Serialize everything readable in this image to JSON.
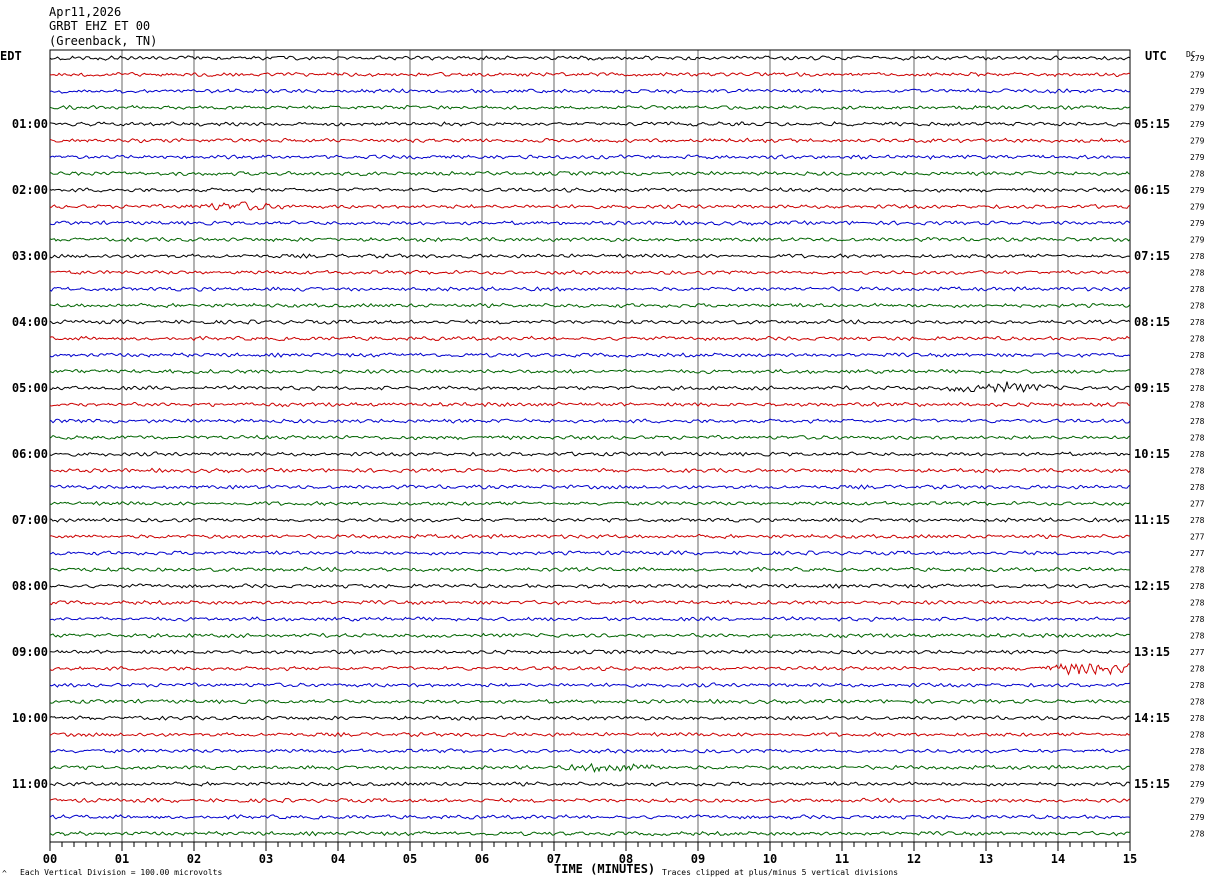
{
  "header": {
    "date": "Apr11,2026",
    "station": "GRBT EHZ ET 00",
    "location": "(Greenback, TN)"
  },
  "left_timezone": "EDT",
  "right_timezone": "UTC",
  "dc_label": "DC",
  "footer": {
    "scale_text": "Each Vertical Division =  100.00 microvolts",
    "clip_text": "Traces clipped at plus/minus 5 vertical divisions",
    "corner_mark": "^"
  },
  "colors": {
    "trace_cycle": [
      "#000000",
      "#cc0000",
      "#0000cc",
      "#006400"
    ],
    "grid": "#000000",
    "background": "#ffffff"
  },
  "chart_data": {
    "type": "line",
    "title": "",
    "xlabel": "TIME (MINUTES)",
    "x_ticks": [
      "00",
      "01",
      "02",
      "03",
      "04",
      "05",
      "06",
      "07",
      "08",
      "09",
      "10",
      "11",
      "12",
      "13",
      "14",
      "15"
    ],
    "xlim": [
      0,
      15
    ],
    "row_count": 48,
    "minutes_per_row": 15,
    "left_labels": [
      "01:00",
      "02:00",
      "03:00",
      "04:00",
      "05:00",
      "06:00",
      "07:00",
      "08:00",
      "09:00",
      "10:00",
      "11:00"
    ],
    "right_labels": [
      "05:15",
      "06:15",
      "07:15",
      "08:15",
      "09:15",
      "10:15",
      "11:15",
      "12:15",
      "13:15",
      "14:15",
      "15:15"
    ],
    "dc_values": [
      "279",
      "279",
      "279",
      "279",
      "279",
      "279",
      "279",
      "278",
      "279",
      "279",
      "279",
      "279",
      "278",
      "278",
      "278",
      "278",
      "278",
      "278",
      "278",
      "278",
      "278",
      "278",
      "278",
      "278",
      "278",
      "278",
      "278",
      "277",
      "278",
      "277",
      "277",
      "278",
      "278",
      "278",
      "278",
      "278",
      "277",
      "278",
      "278",
      "278",
      "278",
      "278",
      "278",
      "278",
      "279",
      "279",
      "279",
      "278"
    ],
    "events": [
      {
        "row": 20,
        "minute": 13.2,
        "amplitude": 2.5
      },
      {
        "row": 9,
        "minute": 2.6,
        "amplitude": 1.6
      },
      {
        "row": 43,
        "minute": 7.9,
        "amplitude": 1.8
      },
      {
        "row": 37,
        "minute": 14.5,
        "amplitude": 3.2
      }
    ]
  }
}
